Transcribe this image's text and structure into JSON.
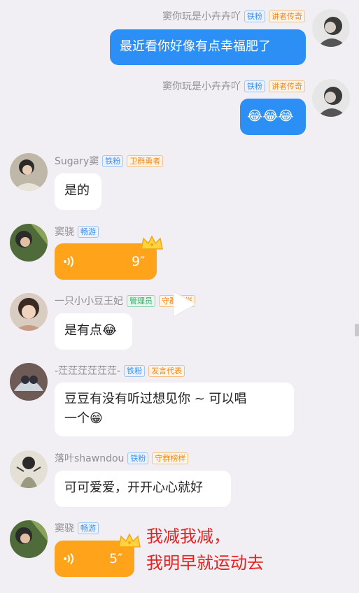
{
  "messages": [
    {
      "id": "m1",
      "side": "right",
      "sender": "窦你玩是小卉卉吖",
      "badges": [
        {
          "text": "铁粉",
          "color": "blue"
        },
        {
          "text": "讲者传奇",
          "color": "orange"
        }
      ],
      "text": "最近看你好像有点幸福肥了"
    },
    {
      "id": "m2",
      "side": "right",
      "sender": "窦你玩是小卉卉吖",
      "badges": [
        {
          "text": "铁粉",
          "color": "blue"
        },
        {
          "text": "讲者传奇",
          "color": "orange"
        }
      ],
      "emoji": "😂😂😂"
    },
    {
      "id": "m3",
      "side": "left",
      "sender": "Sugary窦",
      "badges": [
        {
          "text": "铁粉",
          "color": "blue"
        },
        {
          "text": "卫群勇者",
          "color": "orange"
        }
      ],
      "text": "是的"
    },
    {
      "id": "m4",
      "side": "left",
      "sender": "窦骁",
      "badges": [
        {
          "text": "畅游",
          "color": "blue"
        }
      ],
      "voice_duration": "9″"
    },
    {
      "id": "m5",
      "side": "left",
      "sender": "一只小小豆王妃",
      "badges": [
        {
          "text": "管理员",
          "color": "green"
        },
        {
          "text": "守群榜样",
          "color": "orange"
        }
      ],
      "text": "是有点",
      "emoji": "😂"
    },
    {
      "id": "m6",
      "side": "left",
      "sender": "-茳茳茳茳茳茳-",
      "badges": [
        {
          "text": "铁粉",
          "color": "blue"
        },
        {
          "text": "发言代表",
          "color": "orange"
        }
      ],
      "text_line1": "豆豆有没有听过想见你 ~ 可以唱",
      "text_line2": "一个",
      "emoji": "😁"
    },
    {
      "id": "m7",
      "side": "left",
      "sender": "落叶shawndou",
      "badges": [
        {
          "text": "铁粉",
          "color": "blue"
        },
        {
          "text": "守群榜样",
          "color": "orange"
        }
      ],
      "text": "可可爱爱，开开心心就好"
    },
    {
      "id": "m8",
      "side": "left",
      "sender": "窦骁",
      "badges": [
        {
          "text": "畅游",
          "color": "blue"
        }
      ],
      "voice_duration": "5″"
    }
  ],
  "annotation": {
    "line1": "我减我减，",
    "line2": "我明早就运动去"
  },
  "icons": {
    "play": "play-icon",
    "voice": "voice-wave-icon",
    "crown": "crown-icon"
  }
}
